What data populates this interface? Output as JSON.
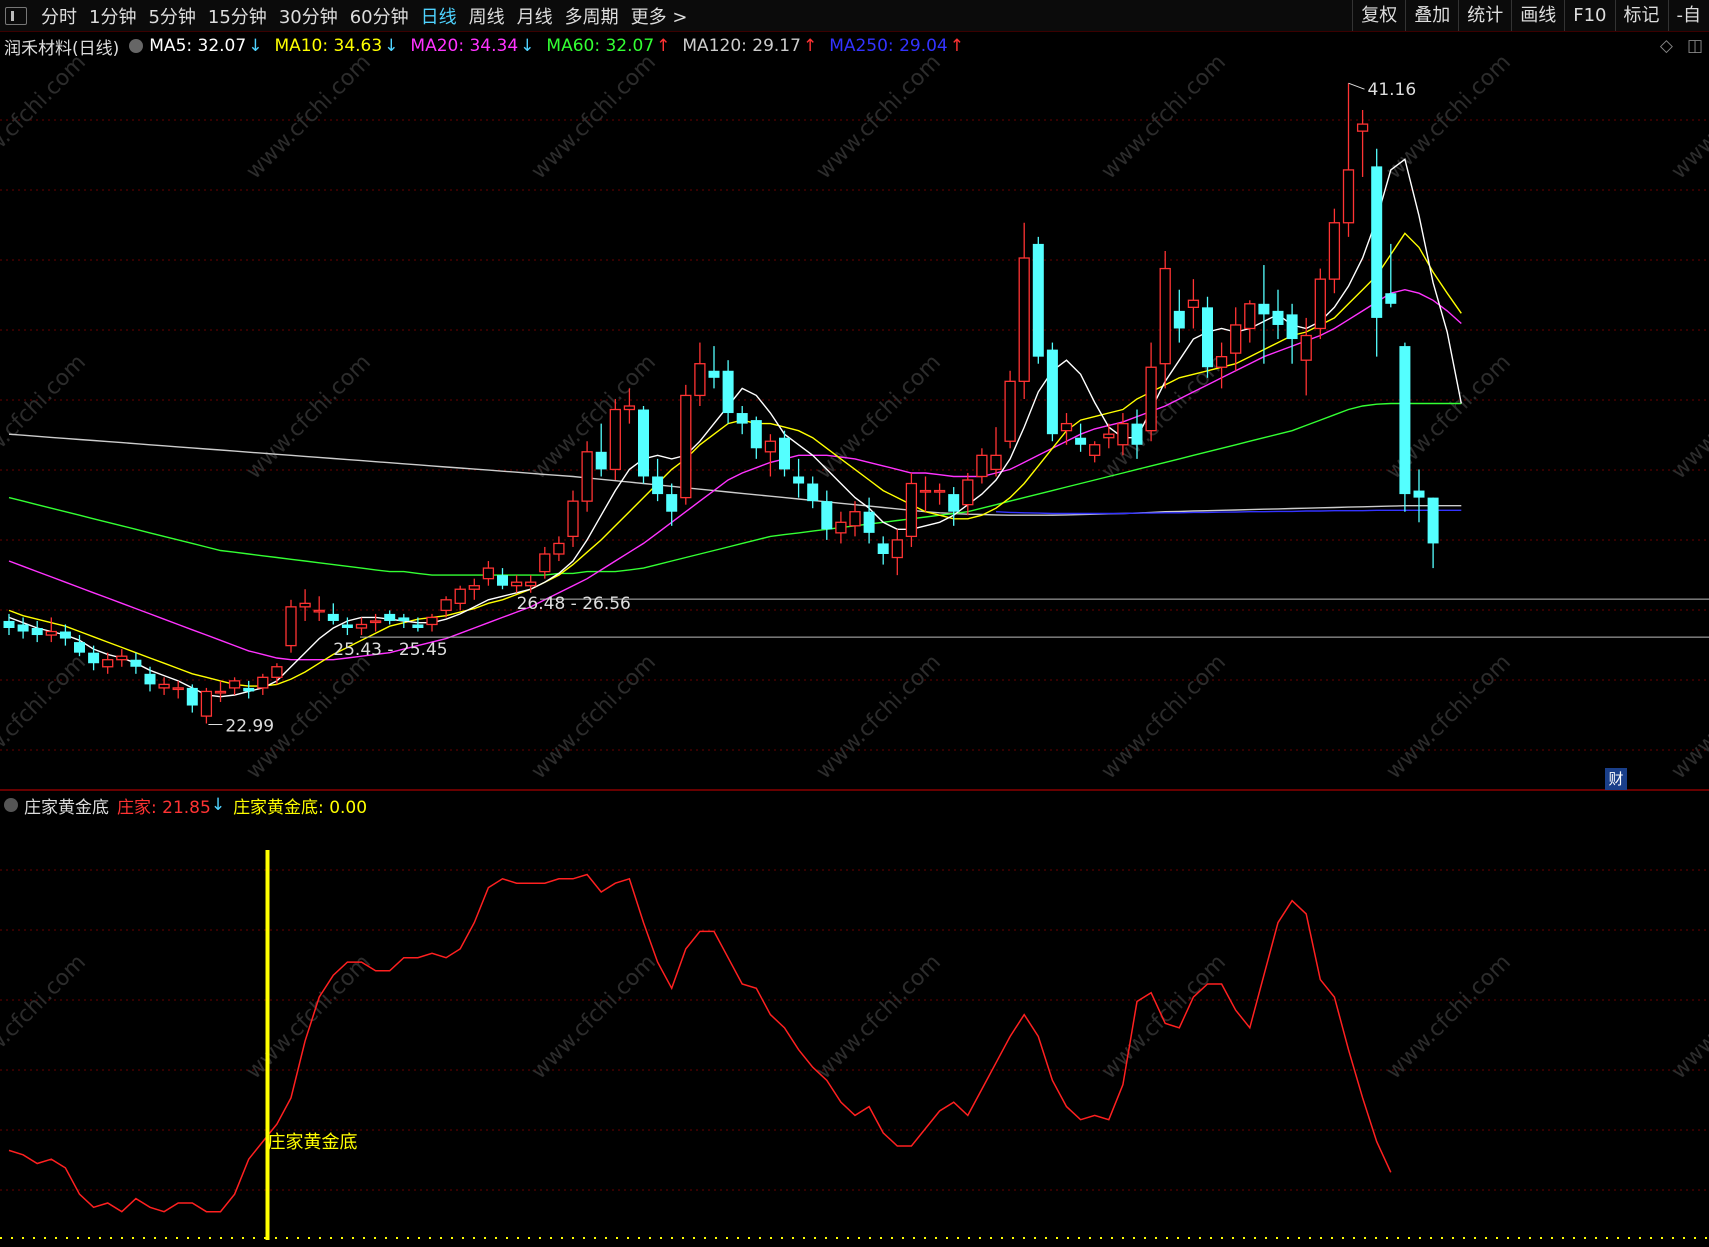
{
  "toolbar": {
    "periods": [
      "分时",
      "1分钟",
      "5分钟",
      "15分钟",
      "30分钟",
      "60分钟",
      "日线",
      "周线",
      "月线",
      "多周期",
      "更多 >"
    ],
    "active_period": "日线",
    "buttons": [
      "复权",
      "叠加",
      "统计",
      "画线",
      "F10",
      "标记",
      "-自"
    ]
  },
  "main_legend": {
    "title": "润禾材料(日线)",
    "ma": [
      {
        "label": "MA5: 32.07",
        "arrow": "↓",
        "color": "#ffffff",
        "arrow_color": "#4fd3ff"
      },
      {
        "label": "MA10: 34.63",
        "arrow": "↓",
        "color": "#ffff00",
        "arrow_color": "#4fd3ff"
      },
      {
        "label": "MA20: 34.34",
        "arrow": "↓",
        "color": "#ff33ff",
        "arrow_color": "#4fd3ff"
      },
      {
        "label": "MA60: 32.07",
        "arrow": "↑",
        "color": "#33ff33",
        "arrow_color": "#ff3333"
      },
      {
        "label": "MA120: 29.17",
        "arrow": "↑",
        "color": "#cccccc",
        "arrow_color": "#ff3333"
      },
      {
        "label": "MA250: 29.04",
        "arrow": "↑",
        "color": "#3333ff",
        "arrow_color": "#ff3333"
      }
    ]
  },
  "indicator_legend": {
    "title": "庄家黄金底",
    "zhuangjia": "庄家: 21.85",
    "zhuangjia_arrow": "↓",
    "golden": "庄家黄金底: 0.00"
  },
  "annotations": {
    "high": "41.16",
    "low": "22.99",
    "range1": "26.48 - 26.56",
    "range2": "25.43 - 25.45",
    "signal": "庄家黄金底",
    "cai": "财"
  },
  "watermark": "www.cfchi.com",
  "colors": {
    "up": "#ff3333",
    "down": "#54ffff",
    "ma5": "#ffffff",
    "ma10": "#ffff00",
    "ma20": "#ff33ff",
    "ma60": "#33ff33",
    "ma120": "#cccccc",
    "ma250": "#3333ff",
    "zhuangjia": "#ff2020",
    "golden": "#ffff00"
  },
  "chart_data": {
    "type": "candlestick",
    "price_range": [
      21.5,
      42.5
    ],
    "high": 41.16,
    "low": 22.99,
    "candles": [
      {
        "o": 25.9,
        "h": 26.1,
        "l": 25.5,
        "c": 25.7
      },
      {
        "o": 25.8,
        "h": 26.0,
        "l": 25.4,
        "c": 25.6
      },
      {
        "o": 25.7,
        "h": 25.9,
        "l": 25.3,
        "c": 25.5
      },
      {
        "o": 25.5,
        "h": 26.0,
        "l": 25.3,
        "c": 25.6
      },
      {
        "o": 25.6,
        "h": 25.8,
        "l": 25.2,
        "c": 25.4
      },
      {
        "o": 25.3,
        "h": 25.5,
        "l": 24.9,
        "c": 25.0
      },
      {
        "o": 25.0,
        "h": 25.2,
        "l": 24.5,
        "c": 24.7
      },
      {
        "o": 24.6,
        "h": 25.0,
        "l": 24.4,
        "c": 24.8
      },
      {
        "o": 24.8,
        "h": 25.1,
        "l": 24.6,
        "c": 24.9
      },
      {
        "o": 24.8,
        "h": 25.0,
        "l": 24.4,
        "c": 24.6
      },
      {
        "o": 24.4,
        "h": 24.6,
        "l": 23.9,
        "c": 24.1
      },
      {
        "o": 24.0,
        "h": 24.3,
        "l": 23.8,
        "c": 24.1
      },
      {
        "o": 24.0,
        "h": 24.2,
        "l": 23.7,
        "c": 24.0
      },
      {
        "o": 24.0,
        "h": 24.1,
        "l": 23.3,
        "c": 23.5
      },
      {
        "o": 23.2,
        "h": 24.0,
        "l": 22.99,
        "c": 23.9
      },
      {
        "o": 23.9,
        "h": 24.2,
        "l": 23.6,
        "c": 23.9
      },
      {
        "o": 24.0,
        "h": 24.3,
        "l": 23.8,
        "c": 24.2
      },
      {
        "o": 24.0,
        "h": 24.2,
        "l": 23.7,
        "c": 23.9
      },
      {
        "o": 24.0,
        "h": 24.4,
        "l": 23.8,
        "c": 24.3
      },
      {
        "o": 24.3,
        "h": 24.7,
        "l": 24.1,
        "c": 24.6
      },
      {
        "o": 25.2,
        "h": 26.5,
        "l": 25.0,
        "c": 26.3
      },
      {
        "o": 26.3,
        "h": 26.8,
        "l": 25.9,
        "c": 26.4
      },
      {
        "o": 26.2,
        "h": 26.6,
        "l": 25.9,
        "c": 26.2
      },
      {
        "o": 26.1,
        "h": 26.4,
        "l": 25.8,
        "c": 25.9
      },
      {
        "o": 25.8,
        "h": 26.0,
        "l": 25.5,
        "c": 25.7
      },
      {
        "o": 25.7,
        "h": 26.0,
        "l": 25.5,
        "c": 25.8
      },
      {
        "o": 25.9,
        "h": 26.1,
        "l": 25.6,
        "c": 25.9
      },
      {
        "o": 26.1,
        "h": 26.2,
        "l": 25.8,
        "c": 25.9
      },
      {
        "o": 26.0,
        "h": 26.1,
        "l": 25.7,
        "c": 25.9
      },
      {
        "o": 25.8,
        "h": 26.0,
        "l": 25.6,
        "c": 25.7
      },
      {
        "o": 25.8,
        "h": 26.1,
        "l": 25.6,
        "c": 26.0
      },
      {
        "o": 26.2,
        "h": 26.6,
        "l": 26.0,
        "c": 26.5
      },
      {
        "o": 26.4,
        "h": 26.9,
        "l": 26.2,
        "c": 26.8
      },
      {
        "o": 26.8,
        "h": 27.1,
        "l": 26.5,
        "c": 26.9
      },
      {
        "o": 27.1,
        "h": 27.6,
        "l": 26.9,
        "c": 27.4
      },
      {
        "o": 27.2,
        "h": 27.4,
        "l": 26.8,
        "c": 26.9
      },
      {
        "o": 26.9,
        "h": 27.2,
        "l": 26.7,
        "c": 27.0
      },
      {
        "o": 26.9,
        "h": 27.2,
        "l": 26.7,
        "c": 27.0
      },
      {
        "o": 27.3,
        "h": 28.0,
        "l": 27.1,
        "c": 27.8
      },
      {
        "o": 27.8,
        "h": 28.3,
        "l": 27.6,
        "c": 28.1
      },
      {
        "o": 28.3,
        "h": 29.6,
        "l": 28.0,
        "c": 29.3
      },
      {
        "o": 29.3,
        "h": 31.0,
        "l": 29.0,
        "c": 30.7
      },
      {
        "o": 30.7,
        "h": 31.5,
        "l": 30.0,
        "c": 30.2
      },
      {
        "o": 30.2,
        "h": 32.2,
        "l": 29.9,
        "c": 31.9
      },
      {
        "o": 31.9,
        "h": 32.5,
        "l": 31.5,
        "c": 32.0
      },
      {
        "o": 31.9,
        "h": 32.0,
        "l": 29.8,
        "c": 30.0
      },
      {
        "o": 30.0,
        "h": 30.5,
        "l": 29.3,
        "c": 29.5
      },
      {
        "o": 29.5,
        "h": 29.8,
        "l": 28.6,
        "c": 29.0
      },
      {
        "o": 29.4,
        "h": 32.6,
        "l": 29.2,
        "c": 32.3
      },
      {
        "o": 32.3,
        "h": 33.8,
        "l": 32.0,
        "c": 33.2
      },
      {
        "o": 33.0,
        "h": 33.7,
        "l": 32.5,
        "c": 32.8
      },
      {
        "o": 33.0,
        "h": 33.3,
        "l": 31.5,
        "c": 31.8
      },
      {
        "o": 31.8,
        "h": 32.0,
        "l": 31.2,
        "c": 31.5
      },
      {
        "o": 31.6,
        "h": 31.7,
        "l": 30.5,
        "c": 30.8
      },
      {
        "o": 30.7,
        "h": 31.2,
        "l": 30.0,
        "c": 31.0
      },
      {
        "o": 31.1,
        "h": 31.3,
        "l": 30.0,
        "c": 30.2
      },
      {
        "o": 30.0,
        "h": 30.5,
        "l": 29.4,
        "c": 29.8
      },
      {
        "o": 29.8,
        "h": 30.0,
        "l": 29.1,
        "c": 29.3
      },
      {
        "o": 29.3,
        "h": 29.6,
        "l": 28.2,
        "c": 28.5
      },
      {
        "o": 28.4,
        "h": 29.0,
        "l": 28.1,
        "c": 28.7
      },
      {
        "o": 28.6,
        "h": 29.3,
        "l": 28.3,
        "c": 29.0
      },
      {
        "o": 29.0,
        "h": 29.4,
        "l": 28.1,
        "c": 28.4
      },
      {
        "o": 28.1,
        "h": 28.3,
        "l": 27.5,
        "c": 27.8
      },
      {
        "o": 27.7,
        "h": 28.5,
        "l": 27.2,
        "c": 28.2
      },
      {
        "o": 28.3,
        "h": 30.1,
        "l": 28.0,
        "c": 29.8
      },
      {
        "o": 29.6,
        "h": 30.0,
        "l": 29.0,
        "c": 29.6
      },
      {
        "o": 29.6,
        "h": 29.8,
        "l": 29.2,
        "c": 29.6
      },
      {
        "o": 29.5,
        "h": 29.7,
        "l": 28.6,
        "c": 29.0
      },
      {
        "o": 29.2,
        "h": 30.1,
        "l": 28.9,
        "c": 29.9
      },
      {
        "o": 30.0,
        "h": 30.8,
        "l": 29.8,
        "c": 30.6
      },
      {
        "o": 30.2,
        "h": 31.4,
        "l": 30.0,
        "c": 30.6
      },
      {
        "o": 31.0,
        "h": 33.0,
        "l": 30.8,
        "c": 32.7
      },
      {
        "o": 32.7,
        "h": 37.2,
        "l": 32.2,
        "c": 36.2
      },
      {
        "o": 36.6,
        "h": 36.8,
        "l": 33.2,
        "c": 33.4
      },
      {
        "o": 33.6,
        "h": 33.8,
        "l": 31.0,
        "c": 31.2
      },
      {
        "o": 31.3,
        "h": 31.8,
        "l": 30.9,
        "c": 31.5
      },
      {
        "o": 31.1,
        "h": 31.5,
        "l": 30.7,
        "c": 30.9
      },
      {
        "o": 30.6,
        "h": 31.0,
        "l": 30.4,
        "c": 30.9
      },
      {
        "o": 31.1,
        "h": 31.5,
        "l": 30.8,
        "c": 31.2
      },
      {
        "o": 30.9,
        "h": 31.8,
        "l": 30.6,
        "c": 31.5
      },
      {
        "o": 31.5,
        "h": 31.9,
        "l": 30.5,
        "c": 30.9
      },
      {
        "o": 31.3,
        "h": 33.8,
        "l": 31.0,
        "c": 33.1
      },
      {
        "o": 33.2,
        "h": 36.4,
        "l": 32.5,
        "c": 35.9
      },
      {
        "o": 34.7,
        "h": 35.3,
        "l": 33.8,
        "c": 34.2
      },
      {
        "o": 34.8,
        "h": 35.6,
        "l": 34.2,
        "c": 35.0
      },
      {
        "o": 34.8,
        "h": 35.1,
        "l": 32.8,
        "c": 33.1
      },
      {
        "o": 33.1,
        "h": 33.8,
        "l": 32.5,
        "c": 33.4
      },
      {
        "o": 33.5,
        "h": 34.8,
        "l": 33.0,
        "c": 34.3
      },
      {
        "o": 34.2,
        "h": 35.0,
        "l": 33.8,
        "c": 34.9
      },
      {
        "o": 34.9,
        "h": 36.0,
        "l": 33.2,
        "c": 34.6
      },
      {
        "o": 34.7,
        "h": 35.3,
        "l": 33.9,
        "c": 34.3
      },
      {
        "o": 34.6,
        "h": 34.9,
        "l": 33.2,
        "c": 33.9
      },
      {
        "o": 33.3,
        "h": 34.5,
        "l": 32.3,
        "c": 34.0
      },
      {
        "o": 34.2,
        "h": 35.9,
        "l": 33.9,
        "c": 35.6
      },
      {
        "o": 35.6,
        "h": 37.6,
        "l": 35.2,
        "c": 37.2
      },
      {
        "o": 37.2,
        "h": 41.16,
        "l": 36.8,
        "c": 38.7
      },
      {
        "o": 39.8,
        "h": 40.4,
        "l": 38.5,
        "c": 40.0
      },
      {
        "o": 38.8,
        "h": 39.3,
        "l": 33.4,
        "c": 34.5
      },
      {
        "o": 35.2,
        "h": 36.6,
        "l": 34.8,
        "c": 34.9
      },
      {
        "o": 33.7,
        "h": 33.8,
        "l": 29.0,
        "c": 29.5
      },
      {
        "o": 29.6,
        "h": 30.2,
        "l": 28.7,
        "c": 29.4
      },
      {
        "o": 29.4,
        "h": 29.4,
        "l": 27.4,
        "c": 28.1
      }
    ],
    "ma5": [
      26.0,
      25.85,
      25.7,
      25.6,
      25.5,
      25.35,
      25.1,
      24.95,
      24.85,
      24.7,
      24.5,
      24.35,
      24.2,
      24.0,
      23.8,
      23.75,
      23.8,
      23.9,
      24.0,
      24.2,
      24.6,
      25.0,
      25.4,
      25.7,
      25.9,
      26.0,
      26.0,
      25.95,
      25.9,
      25.85,
      25.85,
      25.95,
      26.1,
      26.3,
      26.5,
      26.6,
      26.7,
      26.8,
      27.0,
      27.25,
      27.6,
      28.2,
      28.9,
      29.6,
      30.2,
      30.5,
      30.6,
      30.5,
      30.6,
      31.0,
      31.5,
      32.0,
      32.5,
      32.3,
      31.8,
      31.2,
      30.9,
      30.6,
      30.2,
      29.8,
      29.4,
      29.1,
      28.7,
      28.5,
      28.5,
      28.6,
      28.7,
      28.9,
      29.2,
      29.5,
      29.9,
      30.5,
      31.4,
      32.4,
      33.0,
      33.3,
      32.9,
      32.1,
      31.4,
      31.1,
      31.1,
      31.9,
      32.7,
      33.3,
      33.9,
      34.1,
      34.2,
      34.1,
      34.2,
      34.4,
      34.6,
      34.3,
      34.2,
      34.4,
      34.8,
      35.4,
      36.2,
      37.3,
      38.7,
      39.0,
      37.4,
      35.5,
      34.1,
      32.07
    ],
    "ma10": [
      26.2,
      26.05,
      25.95,
      25.85,
      25.75,
      25.6,
      25.45,
      25.3,
      25.15,
      25.0,
      24.85,
      24.7,
      24.55,
      24.4,
      24.3,
      24.2,
      24.1,
      24.05,
      24.05,
      24.1,
      24.25,
      24.45,
      24.7,
      24.95,
      25.15,
      25.35,
      25.55,
      25.75,
      25.85,
      25.95,
      26.0,
      26.05,
      26.15,
      26.25,
      26.4,
      26.5,
      26.65,
      26.8,
      27.0,
      27.2,
      27.5,
      27.85,
      28.2,
      28.6,
      29.0,
      29.4,
      29.8,
      30.2,
      30.5,
      30.9,
      31.2,
      31.5,
      31.6,
      31.5,
      31.5,
      31.4,
      31.3,
      31.1,
      30.8,
      30.5,
      30.2,
      29.9,
      29.6,
      29.4,
      29.2,
      29.0,
      28.9,
      28.8,
      28.8,
      28.9,
      29.1,
      29.4,
      29.8,
      30.3,
      30.8,
      31.3,
      31.6,
      31.7,
      31.8,
      31.9,
      32.2,
      32.4,
      32.6,
      32.8,
      32.9,
      33.0,
      33.1,
      33.2,
      33.4,
      33.6,
      33.8,
      34.0,
      34.1,
      34.3,
      34.5,
      34.9,
      35.3,
      35.7,
      36.3,
      36.9,
      36.5,
      35.8,
      35.2,
      34.63
    ],
    "ma20": [
      27.6,
      27.45,
      27.3,
      27.15,
      27.0,
      26.85,
      26.7,
      26.55,
      26.4,
      26.25,
      26.1,
      25.95,
      25.8,
      25.65,
      25.5,
      25.35,
      25.2,
      25.05,
      24.95,
      24.85,
      24.8,
      24.8,
      24.8,
      24.8,
      24.85,
      24.9,
      24.95,
      25.0,
      25.1,
      25.2,
      25.3,
      25.4,
      25.55,
      25.7,
      25.85,
      26.0,
      26.15,
      26.3,
      26.5,
      26.7,
      26.9,
      27.1,
      27.35,
      27.6,
      27.85,
      28.1,
      28.4,
      28.7,
      29.0,
      29.3,
      29.6,
      29.9,
      30.1,
      30.25,
      30.4,
      30.5,
      30.6,
      30.6,
      30.6,
      30.55,
      30.5,
      30.4,
      30.3,
      30.2,
      30.1,
      30.1,
      30.05,
      30.0,
      30.0,
      30.0,
      30.1,
      30.2,
      30.4,
      30.6,
      30.8,
      31.0,
      31.2,
      31.35,
      31.45,
      31.55,
      31.7,
      31.85,
      32.0,
      32.2,
      32.4,
      32.6,
      32.8,
      33.0,
      33.2,
      33.4,
      33.55,
      33.7,
      33.85,
      34.0,
      34.2,
      34.45,
      34.7,
      34.95,
      35.2,
      35.3,
      35.2,
      35.0,
      34.7,
      34.34
    ],
    "ma60": [
      29.4,
      29.3,
      29.2,
      29.1,
      29.0,
      28.9,
      28.8,
      28.7,
      28.6,
      28.5,
      28.4,
      28.3,
      28.2,
      28.1,
      28.0,
      27.9,
      27.85,
      27.8,
      27.75,
      27.7,
      27.65,
      27.6,
      27.55,
      27.5,
      27.45,
      27.4,
      27.35,
      27.3,
      27.3,
      27.25,
      27.2,
      27.2,
      27.2,
      27.2,
      27.2,
      27.2,
      27.2,
      27.2,
      27.2,
      27.25,
      27.25,
      27.3,
      27.3,
      27.3,
      27.35,
      27.4,
      27.5,
      27.6,
      27.7,
      27.8,
      27.9,
      28.0,
      28.1,
      28.2,
      28.3,
      28.35,
      28.4,
      28.45,
      28.5,
      28.55,
      28.6,
      28.65,
      28.7,
      28.75,
      28.8,
      28.85,
      28.9,
      28.95,
      29.0,
      29.1,
      29.2,
      29.3,
      29.4,
      29.5,
      29.6,
      29.7,
      29.8,
      29.9,
      30.0,
      30.1,
      30.2,
      30.3,
      30.4,
      30.5,
      30.6,
      30.7,
      30.8,
      30.9,
      31.0,
      31.1,
      31.2,
      31.3,
      31.45,
      31.6,
      31.75,
      31.9,
      32.0,
      32.05,
      32.07,
      32.07,
      32.07,
      32.07,
      32.07,
      32.07
    ],
    "ma120": [
      31.2,
      31.17,
      31.14,
      31.11,
      31.08,
      31.05,
      31.02,
      30.99,
      30.96,
      30.93,
      30.9,
      30.87,
      30.84,
      30.81,
      30.78,
      30.75,
      30.72,
      30.69,
      30.66,
      30.63,
      30.6,
      30.57,
      30.54,
      30.51,
      30.48,
      30.45,
      30.42,
      30.39,
      30.36,
      30.33,
      30.3,
      30.27,
      30.24,
      30.21,
      30.18,
      30.15,
      30.12,
      30.09,
      30.06,
      30.03,
      30.0,
      29.96,
      29.92,
      29.88,
      29.84,
      29.8,
      29.76,
      29.72,
      29.68,
      29.64,
      29.6,
      29.56,
      29.52,
      29.48,
      29.44,
      29.4,
      29.36,
      29.32,
      29.28,
      29.24,
      29.2,
      29.16,
      29.12,
      29.08,
      29.04,
      29.0,
      28.97,
      28.95,
      28.93,
      28.92,
      28.91,
      28.9,
      28.9,
      28.9,
      28.9,
      28.91,
      28.92,
      28.93,
      28.94,
      28.95,
      28.96,
      28.98,
      29.0,
      29.01,
      29.02,
      29.03,
      29.04,
      29.05,
      29.06,
      29.07,
      29.08,
      29.09,
      29.1,
      29.11,
      29.12,
      29.13,
      29.14,
      29.15,
      29.16,
      29.17,
      29.17,
      29.17,
      29.17,
      29.17
    ],
    "ma250_start_index": 70,
    "ma250": [
      29.0,
      28.98,
      28.97,
      28.96,
      28.95,
      28.95,
      28.95,
      28.95,
      28.95,
      28.95,
      28.96,
      28.96,
      28.97,
      28.97,
      28.98,
      28.98,
      28.99,
      28.99,
      29.0,
      29.0,
      29.01,
      29.01,
      29.02,
      29.02,
      29.03,
      29.03,
      29.03,
      29.04,
      29.04,
      29.04,
      29.04,
      29.04,
      29.04,
      29.04
    ],
    "indicator": {
      "name": "庄家黄金底",
      "range": [
        0,
        100
      ],
      "zhuangjia": [
        20,
        19,
        17,
        18,
        16,
        10,
        7,
        8,
        6,
        9,
        7,
        6,
        8,
        8,
        6,
        6,
        10,
        18,
        22,
        26,
        32,
        45,
        55,
        60,
        63,
        63,
        61,
        61,
        64,
        64,
        65,
        64,
        66,
        72,
        80,
        82,
        81,
        81,
        81,
        82,
        82,
        83,
        79,
        81,
        82,
        72,
        63,
        57,
        66,
        70,
        70,
        64,
        58,
        57,
        51,
        48,
        43,
        39,
        36,
        31,
        28,
        30,
        24,
        21,
        21,
        25,
        29,
        31,
        28,
        34,
        40,
        46,
        51,
        46,
        36,
        30,
        27,
        28,
        27,
        35,
        54,
        56,
        49,
        48,
        55,
        58,
        58,
        52,
        48,
        60,
        72,
        77,
        74,
        59,
        55,
        43,
        32,
        22,
        15
      ]
    },
    "signal_index": 15
  }
}
